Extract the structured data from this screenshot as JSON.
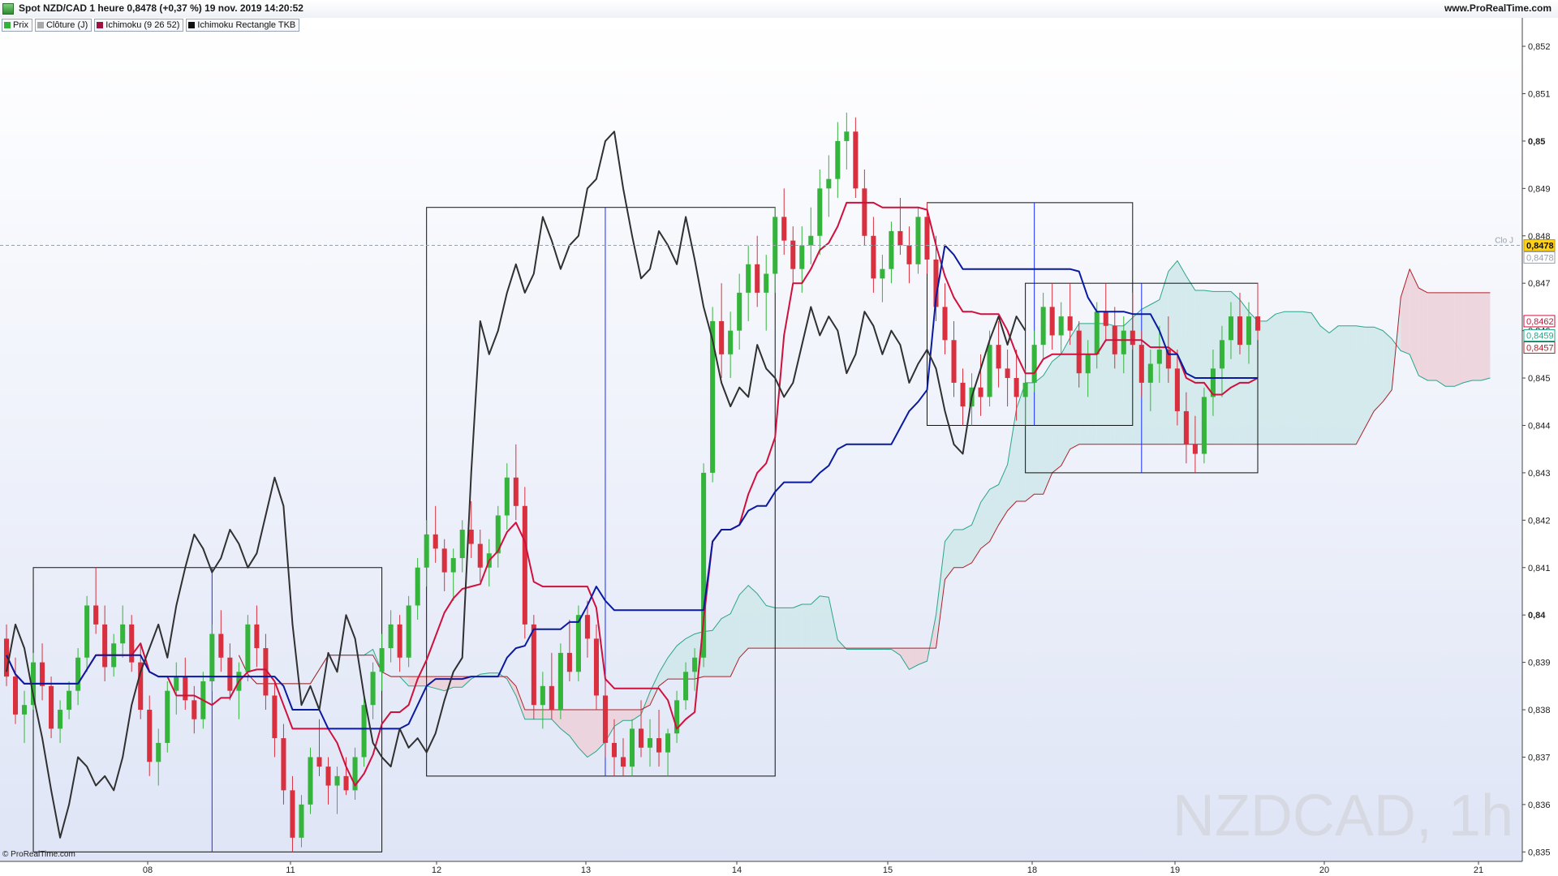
{
  "window": {
    "title": "Spot NZD/CAD 1 heure 0,8478 (+0,37 %) 19 nov. 2019 14:20:52",
    "brand": "www.ProRealTime.com"
  },
  "legend": [
    {
      "label": "Prix",
      "color": "#33b33a"
    },
    {
      "label": "Clôture (J)",
      "color": "#a8a8a8"
    },
    {
      "label": "Ichimoku (9 26 52)",
      "color": "#a01040"
    },
    {
      "label": "Ichimoku Rectangle TKB",
      "color": "#111111"
    }
  ],
  "watermark": "NZDCAD, 1h",
  "copyright": "© ProRealTime.com",
  "close_label": "Clo J",
  "colors": {
    "up": "#35b43c",
    "down": "#d8303f",
    "tenkan": "#d0103c",
    "kijun": "#0a1aa0",
    "chikou": "#303030",
    "senkou_a": "#2aa58a",
    "senkou_b": "#b0202a",
    "cloud_bull": "#cfe8ea",
    "cloud_bear": "#ecd0d8",
    "rect": "#111111",
    "rect_vline": "#1a2cff",
    "rect_red": "#d03040"
  },
  "chart_data": {
    "type": "candlestick",
    "title": "Spot NZD/CAD 1 heure",
    "y_ticks": [
      "0,852",
      "0,851",
      "0,85",
      "0,849",
      "0,848",
      "0,847",
      "0,846",
      "0,845",
      "0,844",
      "0,843",
      "0,842",
      "0,841",
      "0,84",
      "0,839",
      "0,838",
      "0,837",
      "0,836",
      "0,835"
    ],
    "ylim": [
      0.8348,
      0.8526
    ],
    "x_labels": [
      "08",
      "11",
      "12",
      "13",
      "14",
      "15",
      "18",
      "19",
      "20",
      "21"
    ],
    "last_price": "0,8478",
    "previous_close": "0,8478",
    "price_tags": [
      {
        "value": "0,8478",
        "style": "last"
      },
      {
        "value": "0,8478",
        "style": "close"
      },
      {
        "value": "0,8462",
        "style": "tenkan"
      },
      {
        "value": "0,8459",
        "style": "senkou_a"
      },
      {
        "value": "0,8457",
        "style": "senkou_b"
      }
    ],
    "candles": [
      [
        0.8395,
        0.8398,
        0.8385,
        0.8387
      ],
      [
        0.8387,
        0.8391,
        0.8377,
        0.8379
      ],
      [
        0.8379,
        0.8384,
        0.8373,
        0.8381
      ],
      [
        0.8381,
        0.8392,
        0.838,
        0.839
      ],
      [
        0.839,
        0.8394,
        0.8382,
        0.8385
      ],
      [
        0.8385,
        0.8387,
        0.8374,
        0.8376
      ],
      [
        0.8376,
        0.8382,
        0.8373,
        0.838
      ],
      [
        0.838,
        0.8386,
        0.8378,
        0.8384
      ],
      [
        0.8384,
        0.8393,
        0.8381,
        0.8391
      ],
      [
        0.8391,
        0.8404,
        0.8388,
        0.8402
      ],
      [
        0.8402,
        0.841,
        0.8396,
        0.8398
      ],
      [
        0.8398,
        0.8402,
        0.8386,
        0.8389
      ],
      [
        0.8389,
        0.8396,
        0.8387,
        0.8394
      ],
      [
        0.8394,
        0.8402,
        0.8391,
        0.8398
      ],
      [
        0.8398,
        0.84,
        0.8388,
        0.839
      ],
      [
        0.839,
        0.8394,
        0.8378,
        0.838
      ],
      [
        0.838,
        0.8383,
        0.8366,
        0.8369
      ],
      [
        0.8369,
        0.8376,
        0.8364,
        0.8373
      ],
      [
        0.8373,
        0.8386,
        0.8371,
        0.8384
      ],
      [
        0.8384,
        0.839,
        0.8379,
        0.8387
      ],
      [
        0.8387,
        0.8391,
        0.838,
        0.8382
      ],
      [
        0.8382,
        0.8385,
        0.8375,
        0.8378
      ],
      [
        0.8378,
        0.8388,
        0.8376,
        0.8386
      ],
      [
        0.8386,
        0.8398,
        0.8384,
        0.8396
      ],
      [
        0.8396,
        0.8401,
        0.8388,
        0.8391
      ],
      [
        0.8391,
        0.8394,
        0.8382,
        0.8384
      ],
      [
        0.8384,
        0.839,
        0.8378,
        0.8388
      ],
      [
        0.8388,
        0.84,
        0.8386,
        0.8398
      ],
      [
        0.8398,
        0.8402,
        0.8389,
        0.8393
      ],
      [
        0.8393,
        0.8396,
        0.838,
        0.8383
      ],
      [
        0.8383,
        0.8386,
        0.837,
        0.8374
      ],
      [
        0.8374,
        0.8377,
        0.836,
        0.8363
      ],
      [
        0.8363,
        0.8366,
        0.835,
        0.8353
      ],
      [
        0.8353,
        0.8362,
        0.8351,
        0.836
      ],
      [
        0.836,
        0.8372,
        0.8358,
        0.837
      ],
      [
        0.837,
        0.8378,
        0.8366,
        0.8368
      ],
      [
        0.8368,
        0.837,
        0.836,
        0.8364
      ],
      [
        0.8364,
        0.8368,
        0.8358,
        0.8366
      ],
      [
        0.8366,
        0.837,
        0.8362,
        0.8363
      ],
      [
        0.8363,
        0.8372,
        0.8361,
        0.837
      ],
      [
        0.837,
        0.8383,
        0.8368,
        0.8381
      ],
      [
        0.8381,
        0.839,
        0.8378,
        0.8388
      ],
      [
        0.8388,
        0.8396,
        0.8384,
        0.8393
      ],
      [
        0.8393,
        0.8401,
        0.839,
        0.8398
      ],
      [
        0.8398,
        0.84,
        0.8388,
        0.8391
      ],
      [
        0.8391,
        0.8404,
        0.8389,
        0.8402
      ],
      [
        0.8402,
        0.8412,
        0.8399,
        0.841
      ],
      [
        0.841,
        0.842,
        0.8406,
        0.8417
      ],
      [
        0.8417,
        0.8423,
        0.8411,
        0.8414
      ],
      [
        0.8414,
        0.8416,
        0.8405,
        0.8409
      ],
      [
        0.8409,
        0.8414,
        0.8403,
        0.8412
      ],
      [
        0.8412,
        0.842,
        0.8409,
        0.8418
      ],
      [
        0.8418,
        0.8424,
        0.8412,
        0.8415
      ],
      [
        0.8415,
        0.8418,
        0.8407,
        0.841
      ],
      [
        0.841,
        0.8416,
        0.8406,
        0.8413
      ],
      [
        0.8413,
        0.8423,
        0.841,
        0.8421
      ],
      [
        0.8421,
        0.8432,
        0.8418,
        0.8429
      ],
      [
        0.8429,
        0.8436,
        0.842,
        0.8423
      ],
      [
        0.8423,
        0.8427,
        0.8395,
        0.8398
      ],
      [
        0.8398,
        0.84,
        0.8378,
        0.8381
      ],
      [
        0.8381,
        0.8388,
        0.8376,
        0.8385
      ],
      [
        0.8385,
        0.8392,
        0.8378,
        0.838
      ],
      [
        0.838,
        0.8394,
        0.8378,
        0.8392
      ],
      [
        0.8392,
        0.8399,
        0.8386,
        0.8388
      ],
      [
        0.8388,
        0.8402,
        0.8386,
        0.84
      ],
      [
        0.84,
        0.8403,
        0.8391,
        0.8395
      ],
      [
        0.8395,
        0.8398,
        0.838,
        0.8383
      ],
      [
        0.8383,
        0.8386,
        0.837,
        0.8373
      ],
      [
        0.8373,
        0.8378,
        0.8366,
        0.837
      ],
      [
        0.837,
        0.8374,
        0.8366,
        0.8368
      ],
      [
        0.8368,
        0.8378,
        0.8366,
        0.8376
      ],
      [
        0.8376,
        0.8382,
        0.837,
        0.8372
      ],
      [
        0.8372,
        0.8378,
        0.8368,
        0.8374
      ],
      [
        0.8374,
        0.838,
        0.8368,
        0.8371
      ],
      [
        0.8371,
        0.8376,
        0.8366,
        0.8375
      ],
      [
        0.8375,
        0.8384,
        0.8373,
        0.8382
      ],
      [
        0.8382,
        0.839,
        0.838,
        0.8388
      ],
      [
        0.8388,
        0.8393,
        0.8384,
        0.8391
      ],
      [
        0.8391,
        0.8432,
        0.8389,
        0.843
      ],
      [
        0.843,
        0.8465,
        0.8428,
        0.8462
      ],
      [
        0.8462,
        0.847,
        0.845,
        0.8455
      ],
      [
        0.8455,
        0.8464,
        0.845,
        0.846
      ],
      [
        0.846,
        0.8472,
        0.8456,
        0.8468
      ],
      [
        0.8468,
        0.8478,
        0.8462,
        0.8474
      ],
      [
        0.8474,
        0.848,
        0.8465,
        0.8468
      ],
      [
        0.8468,
        0.8476,
        0.846,
        0.8472
      ],
      [
        0.8472,
        0.8486,
        0.8468,
        0.8484
      ],
      [
        0.8484,
        0.849,
        0.8476,
        0.8479
      ],
      [
        0.8479,
        0.8482,
        0.847,
        0.8473
      ],
      [
        0.8473,
        0.8482,
        0.8468,
        0.8478
      ],
      [
        0.8478,
        0.8486,
        0.8474,
        0.848
      ],
      [
        0.848,
        0.8494,
        0.8476,
        0.849
      ],
      [
        0.849,
        0.8497,
        0.8484,
        0.8492
      ],
      [
        0.8492,
        0.8504,
        0.8488,
        0.85
      ],
      [
        0.85,
        0.8506,
        0.8494,
        0.8502
      ],
      [
        0.8502,
        0.8505,
        0.8488,
        0.849
      ],
      [
        0.849,
        0.8494,
        0.8478,
        0.848
      ],
      [
        0.848,
        0.8484,
        0.8468,
        0.8471
      ],
      [
        0.8471,
        0.8476,
        0.8466,
        0.8473
      ],
      [
        0.8473,
        0.8483,
        0.847,
        0.8481
      ],
      [
        0.8481,
        0.8488,
        0.8476,
        0.8478
      ],
      [
        0.8478,
        0.8482,
        0.847,
        0.8474
      ],
      [
        0.8474,
        0.8486,
        0.8472,
        0.8484
      ],
      [
        0.8484,
        0.8487,
        0.8472,
        0.8475
      ],
      [
        0.8475,
        0.848,
        0.8462,
        0.8465
      ],
      [
        0.8465,
        0.847,
        0.8455,
        0.8458
      ],
      [
        0.8458,
        0.8462,
        0.8446,
        0.8449
      ],
      [
        0.8449,
        0.8452,
        0.844,
        0.8444
      ],
      [
        0.8444,
        0.8451,
        0.844,
        0.8448
      ],
      [
        0.8448,
        0.8455,
        0.8442,
        0.8446
      ],
      [
        0.8446,
        0.846,
        0.8444,
        0.8457
      ],
      [
        0.8457,
        0.8462,
        0.8448,
        0.8452
      ],
      [
        0.8452,
        0.8456,
        0.8444,
        0.845
      ],
      [
        0.845,
        0.8456,
        0.8441,
        0.8446
      ],
      [
        0.8446,
        0.8452,
        0.844,
        0.8449
      ],
      [
        0.8449,
        0.846,
        0.8447,
        0.8457
      ],
      [
        0.8457,
        0.8468,
        0.8454,
        0.8465
      ],
      [
        0.8465,
        0.847,
        0.8456,
        0.8459
      ],
      [
        0.8459,
        0.8466,
        0.8455,
        0.8463
      ],
      [
        0.8463,
        0.847,
        0.8457,
        0.846
      ],
      [
        0.846,
        0.8462,
        0.8448,
        0.8451
      ],
      [
        0.8451,
        0.8458,
        0.8446,
        0.8455
      ],
      [
        0.8455,
        0.8466,
        0.8452,
        0.8464
      ],
      [
        0.8464,
        0.847,
        0.8458,
        0.8461
      ],
      [
        0.8461,
        0.8465,
        0.8452,
        0.8455
      ],
      [
        0.8455,
        0.8463,
        0.8451,
        0.846
      ],
      [
        0.846,
        0.8468,
        0.8456,
        0.8457
      ],
      [
        0.8457,
        0.846,
        0.8446,
        0.8449
      ],
      [
        0.8449,
        0.8456,
        0.8443,
        0.8453
      ],
      [
        0.8453,
        0.8461,
        0.8449,
        0.8456
      ],
      [
        0.8456,
        0.8463,
        0.8449,
        0.8452
      ],
      [
        0.8452,
        0.8456,
        0.844,
        0.8443
      ],
      [
        0.8443,
        0.8447,
        0.8432,
        0.8436
      ],
      [
        0.8436,
        0.8442,
        0.843,
        0.8434
      ],
      [
        0.8434,
        0.8448,
        0.8432,
        0.8446
      ],
      [
        0.8446,
        0.8456,
        0.8442,
        0.8452
      ],
      [
        0.8452,
        0.8461,
        0.8446,
        0.8458
      ],
      [
        0.8458,
        0.8466,
        0.8454,
        0.8463
      ],
      [
        0.8463,
        0.8468,
        0.8455,
        0.8457
      ],
      [
        0.8457,
        0.8466,
        0.8453,
        0.8463
      ],
      [
        0.8463,
        0.847,
        0.8458,
        0.846
      ]
    ]
  }
}
